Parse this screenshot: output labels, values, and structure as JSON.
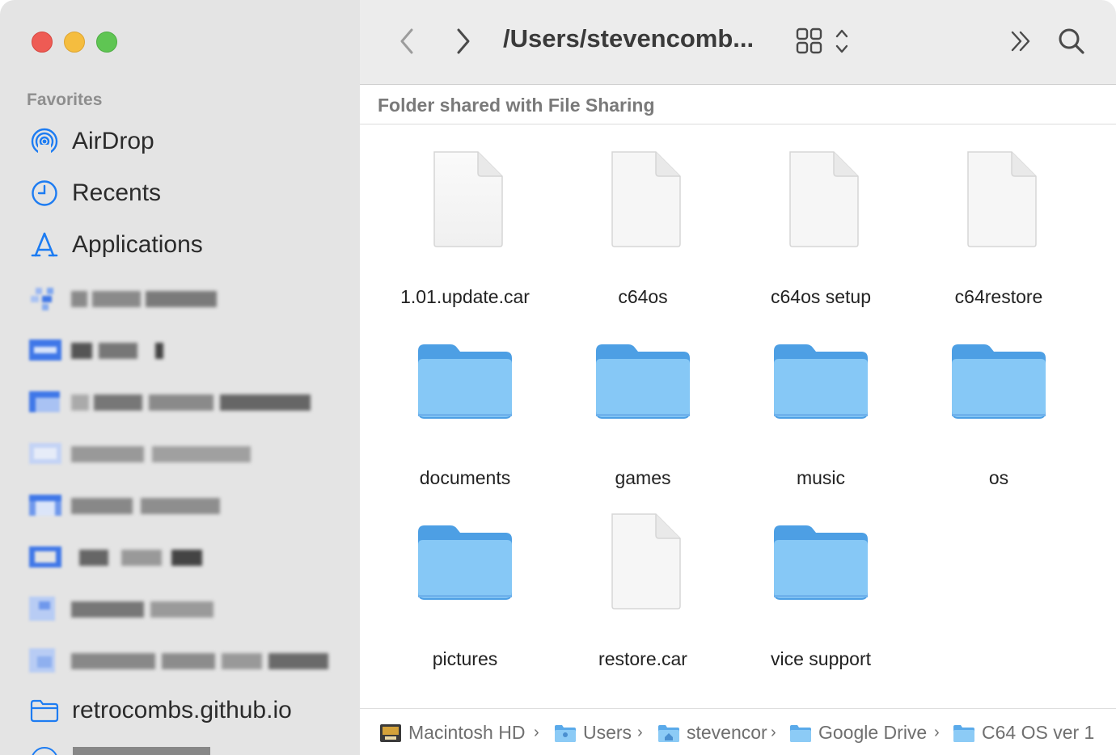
{
  "toolbar": {
    "path_title": "/Users/stevencomb...",
    "back_icon": "chevron-left-icon",
    "forward_icon": "chevron-right-icon",
    "view_icon": "grid-view-icon",
    "more_icon": "double-chevron-icon",
    "search_icon": "search-icon"
  },
  "sidebar": {
    "section_title": "Favorites",
    "items": [
      {
        "label": "AirDrop",
        "icon": "airdrop-icon"
      },
      {
        "label": "Recents",
        "icon": "clock-icon"
      },
      {
        "label": "Applications",
        "icon": "applications-icon"
      },
      {
        "label": "retrocombs.github.io",
        "icon": "folder-icon"
      }
    ]
  },
  "banner": {
    "text": "Folder shared with File Sharing"
  },
  "files": [
    {
      "name": "1.01.update.car",
      "kind": "document"
    },
    {
      "name": "c64os",
      "kind": "document"
    },
    {
      "name": "c64os setup",
      "kind": "document"
    },
    {
      "name": "c64restore",
      "kind": "document"
    },
    {
      "name": "documents",
      "kind": "folder"
    },
    {
      "name": "games",
      "kind": "folder"
    },
    {
      "name": "music",
      "kind": "folder"
    },
    {
      "name": "os",
      "kind": "folder"
    },
    {
      "name": "pictures",
      "kind": "folder"
    },
    {
      "name": "restore.car",
      "kind": "document"
    },
    {
      "name": "vice support",
      "kind": "folder"
    }
  ],
  "pathbar": {
    "crumbs": [
      {
        "label": "Macintosh HD",
        "icon": "hard-drive-icon"
      },
      {
        "label": "Users",
        "icon": "users-folder-icon"
      },
      {
        "label": "stevencor",
        "icon": "home-folder-icon"
      },
      {
        "label": "Google Drive",
        "icon": "folder-icon"
      },
      {
        "label": "C64 OS ver 1",
        "icon": "folder-icon"
      }
    ]
  },
  "colors": {
    "accent": "#1d7cf2",
    "folder": "#7ec1f3",
    "sidebar_bg": "#e4e4e4"
  }
}
